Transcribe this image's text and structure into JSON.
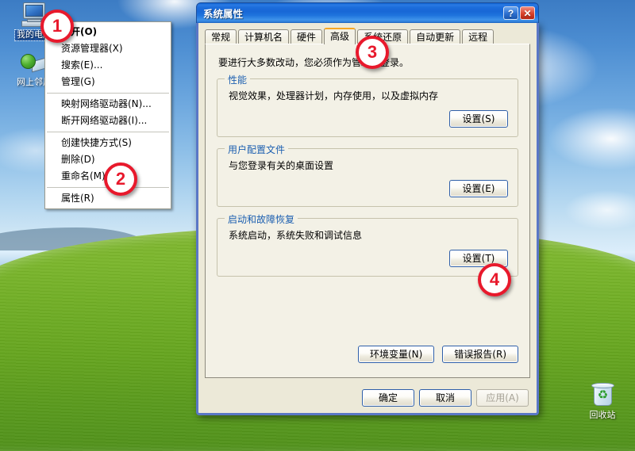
{
  "desktop": {
    "icons": [
      {
        "name": "my-computer",
        "label": "我的电脑",
        "selected": true
      },
      {
        "name": "network-places",
        "label": "网上邻居",
        "selected": false
      },
      {
        "name": "recycle-bin",
        "label": "回收站",
        "selected": false
      }
    ]
  },
  "context_menu": {
    "items": [
      {
        "label": "打开(O)",
        "bold": true
      },
      {
        "label": "资源管理器(X)",
        "bold": false
      },
      {
        "label": "搜索(E)...",
        "bold": false
      },
      {
        "label": "管理(G)",
        "bold": false
      },
      {
        "separator": true
      },
      {
        "label": "映射网络驱动器(N)...",
        "bold": false
      },
      {
        "label": "断开网络驱动器(I)...",
        "bold": false
      },
      {
        "separator": true
      },
      {
        "label": "创建快捷方式(S)",
        "bold": false
      },
      {
        "label": "删除(D)",
        "bold": false
      },
      {
        "label": "重命名(M)",
        "bold": false
      },
      {
        "separator": true
      },
      {
        "label": "属性(R)",
        "bold": false
      }
    ]
  },
  "dialog": {
    "title": "系统属性",
    "help_button": "?",
    "close_button": "✕",
    "tabs": [
      {
        "label": "常规",
        "active": false
      },
      {
        "label": "计算机名",
        "active": false
      },
      {
        "label": "硬件",
        "active": false
      },
      {
        "label": "高级",
        "active": true
      },
      {
        "label": "系统还原",
        "active": false
      },
      {
        "label": "自动更新",
        "active": false
      },
      {
        "label": "远程",
        "active": false
      }
    ],
    "intro": "要进行大多数改动，您必须作为管理员登录。",
    "groups": [
      {
        "legend": "性能",
        "description": "视觉效果，处理器计划，内存使用，以及虚拟内存",
        "button": "设置(S)"
      },
      {
        "legend": "用户配置文件",
        "description": "与您登录有关的桌面设置",
        "button": "设置(E)"
      },
      {
        "legend": "启动和故障恢复",
        "description": "系统启动，系统失败和调试信息",
        "button": "设置(T)"
      }
    ],
    "lower_buttons": [
      {
        "label": "环境变量(N)",
        "disabled": false
      },
      {
        "label": "错误报告(R)",
        "disabled": false
      }
    ],
    "footer_buttons": [
      {
        "label": "确定",
        "disabled": false,
        "default": true
      },
      {
        "label": "取消",
        "disabled": false,
        "default": false
      },
      {
        "label": "应用(A)",
        "disabled": true,
        "default": false
      }
    ]
  },
  "annotations": {
    "badges": [
      {
        "number": "1",
        "target": "context-menu-open-item"
      },
      {
        "number": "2",
        "target": "context-menu-properties-item"
      },
      {
        "number": "3",
        "target": "advanced-tab"
      },
      {
        "number": "4",
        "target": "startup-recovery-settings-button"
      }
    ],
    "accent_color": "#e8192c"
  }
}
